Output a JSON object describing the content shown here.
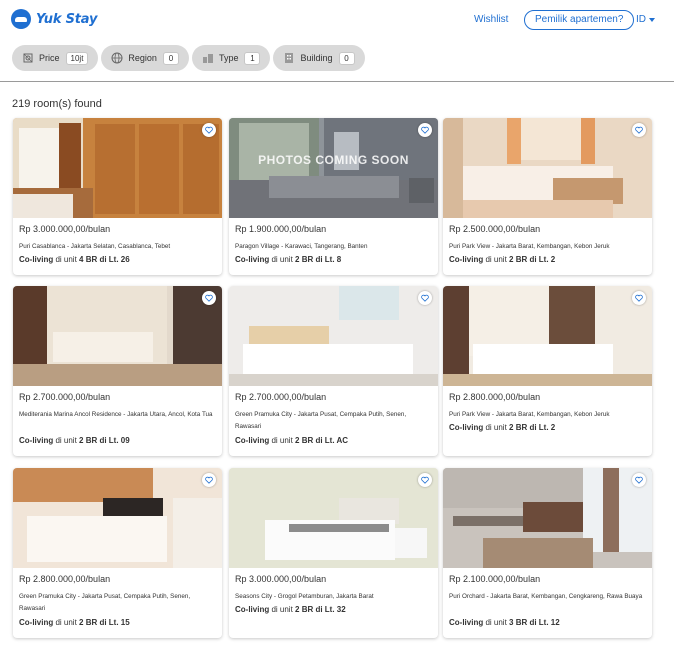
{
  "header": {
    "logo_text": "Yuk Stay",
    "wishlist": "Wishlist",
    "owner_button": "Pemilik apartemen?",
    "language": "ID"
  },
  "filters": [
    {
      "icon": "price-icon",
      "label": "Price",
      "value": "10jt"
    },
    {
      "icon": "globe-icon",
      "label": "Region",
      "value": "0"
    },
    {
      "icon": "building-type-icon",
      "label": "Type",
      "value": "1"
    },
    {
      "icon": "building-icon",
      "label": "Building",
      "value": "0"
    }
  ],
  "results_count": "219 room(s) found",
  "listings": [
    {
      "price": "Rp 3.000.000,00/bulan",
      "location": "Puri Casablanca - Jakarta Selatan, Casablanca, Tebet",
      "type": "Co-living",
      "middle": " di unit ",
      "unit": "4 BR di Lt. 26",
      "photo": "bedroom-window-wardrobe"
    },
    {
      "price": "Rp 1.900.000,00/bulan",
      "location": "Paragon Village - Karawaci, Tangerang, Banten",
      "type": "Co-living",
      "middle": " di unit ",
      "unit": "2 BR di Lt. 8",
      "photo": "photos-coming-soon",
      "placeholder_text": "PHOTOS COMING SOON"
    },
    {
      "price": "Rp 2.500.000,00/bulan",
      "location": "Puri Park View - Jakarta Barat, Kembangan, Kebon Jeruk",
      "type": "Co-living",
      "middle": " di unit ",
      "unit": "2 BR di Lt. 2",
      "photo": "bedroom-curtains"
    },
    {
      "price": "Rp 2.700.000,00/bulan",
      "location": "Mediterania Marina Ancol Residence - Jakarta Utara, Ancol, Kota Tua",
      "type": "Co-living",
      "middle": " di unit ",
      "unit": "2 BR di Lt. 09",
      "photo": "bedroom-dark-door"
    },
    {
      "price": "Rp 2.700.000,00/bulan",
      "location": "Green Pramuka City - Jakarta Pusat, Cempaka Putih, Senen, Rawasari",
      "type": "Co-living",
      "middle": " di unit ",
      "unit": "2 BR di Lt. AC",
      "photo": "bedroom-wood-headboard"
    },
    {
      "price": "Rp 2.800.000,00/bulan",
      "location": "Puri Park View - Jakarta Barat, Kembangan, Kebon Jeruk",
      "type": "Co-living",
      "middle": " di unit ",
      "unit": "2 BR di Lt. 2",
      "photo": "bedroom-brown-curtains"
    },
    {
      "price": "Rp 2.800.000,00/bulan",
      "location": "Green Pramuka City - Jakarta Pusat, Cempaka Putih, Senen, Rawasari",
      "type": "Co-living",
      "middle": " di unit ",
      "unit": "2 BR di Lt. 15",
      "photo": "bedroom-black-headboard"
    },
    {
      "price": "Rp 3.000.000,00/bulan",
      "location": "Seasons City - Grogol Petamburan, Jakarta Barat",
      "type": "Co-living",
      "middle": " di unit ",
      "unit": "2 BR di Lt. 32",
      "photo": "bedroom-floral-wall"
    },
    {
      "price": "Rp 2.100.000,00/bulan",
      "location": "Puri Orchard - Jakarta Barat, Kembangan, Cengkareng, Rawa Buaya",
      "type": "Co-living",
      "middle": " di unit ",
      "unit": "3 BR di Lt. 12",
      "photo": "living-room-sofa"
    }
  ],
  "colors": {
    "brand": "#1f6fd1",
    "chip_bg": "#d9d9d9"
  }
}
